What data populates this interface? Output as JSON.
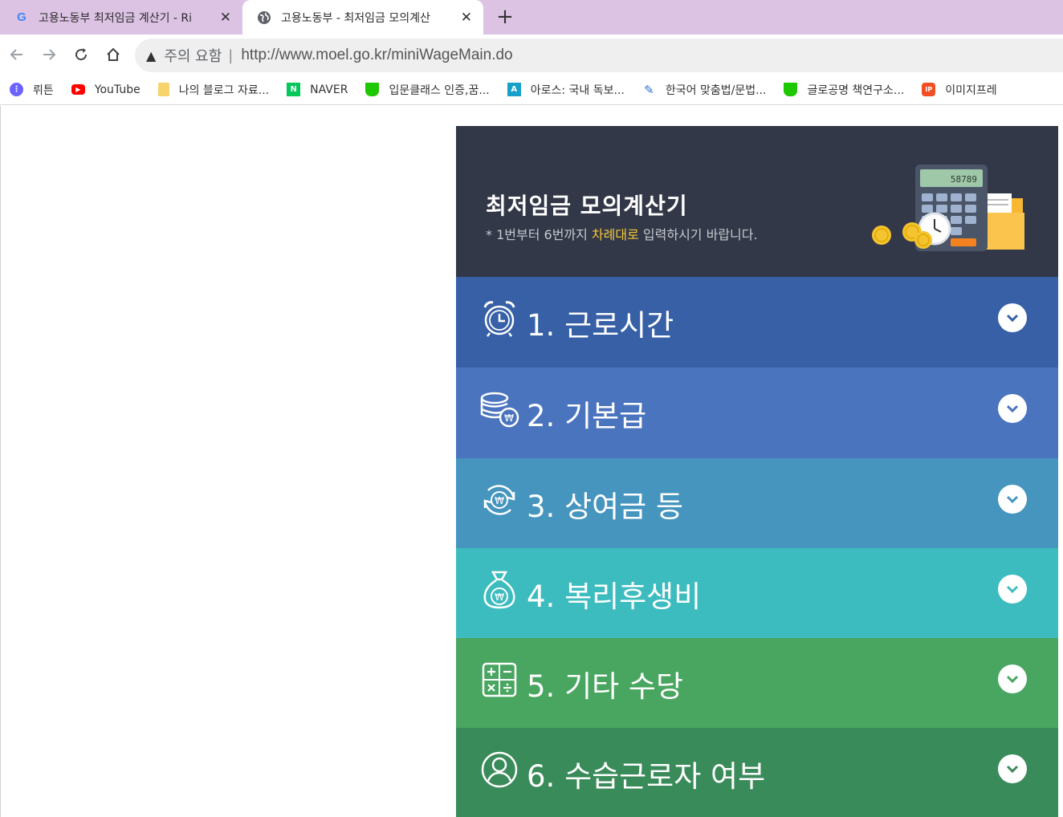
{
  "browser": {
    "tabs": [
      {
        "title": "고용노동부 최저임금 계산기 - Ri",
        "icon": "google-icon",
        "active": false
      },
      {
        "title": "고용노동부 - 최저임금 모의계산",
        "icon": "globe-icon",
        "active": true
      }
    ],
    "new_tab_symbol": "+",
    "close_symbol": "✕",
    "address": {
      "security_label": "주의 요함",
      "separator": "|",
      "url": "http://www.moel.go.kr/miniWageMain.do"
    },
    "bookmarks": [
      {
        "label": "뤼튼",
        "icon": "wrtn-icon",
        "color": "#6c63ff"
      },
      {
        "label": "YouTube",
        "icon": "youtube-icon",
        "color": "#ff0000"
      },
      {
        "label": "나의 블로그 자료...",
        "icon": "folder-icon",
        "color": "#f6d36b"
      },
      {
        "label": "NAVER",
        "icon": "naver-icon",
        "color": "#03c75a"
      },
      {
        "label": "입문클래스 인증,꿈...",
        "icon": "cafe-icon",
        "color": "#1ec800"
      },
      {
        "label": "아로스: 국내 독보...",
        "icon": "aros-icon",
        "color": "#18a0c8"
      },
      {
        "label": "한국어 맞춤법/문법...",
        "icon": "spellcheck-icon",
        "color": "#2f6fd6"
      },
      {
        "label": "글로공명 책연구소...",
        "icon": "cafe-icon",
        "color": "#1ec800"
      },
      {
        "label": "이미지프레",
        "icon": "ip-icon",
        "color": "#f04e23"
      }
    ]
  },
  "calculator": {
    "title": "최저임금 모의계산기",
    "subtitle_prefix": "* 1번부터 6번까지 ",
    "subtitle_highlight": "차례대로",
    "subtitle_suffix": " 입력하시기 바랍니다.",
    "display_value": "58789",
    "header_bg": "#323847",
    "sections": [
      {
        "label": "1. 근로시간",
        "icon": "alarm-clock-icon",
        "color": "#3760a6"
      },
      {
        "label": "2. 기본급",
        "icon": "coins-icon",
        "color": "#4b74bf"
      },
      {
        "label": "3. 상여금 등",
        "icon": "won-cycle-icon",
        "color": "#4595bf"
      },
      {
        "label": "4. 복리후생비",
        "icon": "money-bag-icon",
        "color": "#3dbcbf"
      },
      {
        "label": "5. 기타 수당",
        "icon": "calculator-icon",
        "color": "#48a660"
      },
      {
        "label": "6. 수습근로자 여부",
        "icon": "person-icon",
        "color": "#3a8b5a"
      }
    ]
  }
}
